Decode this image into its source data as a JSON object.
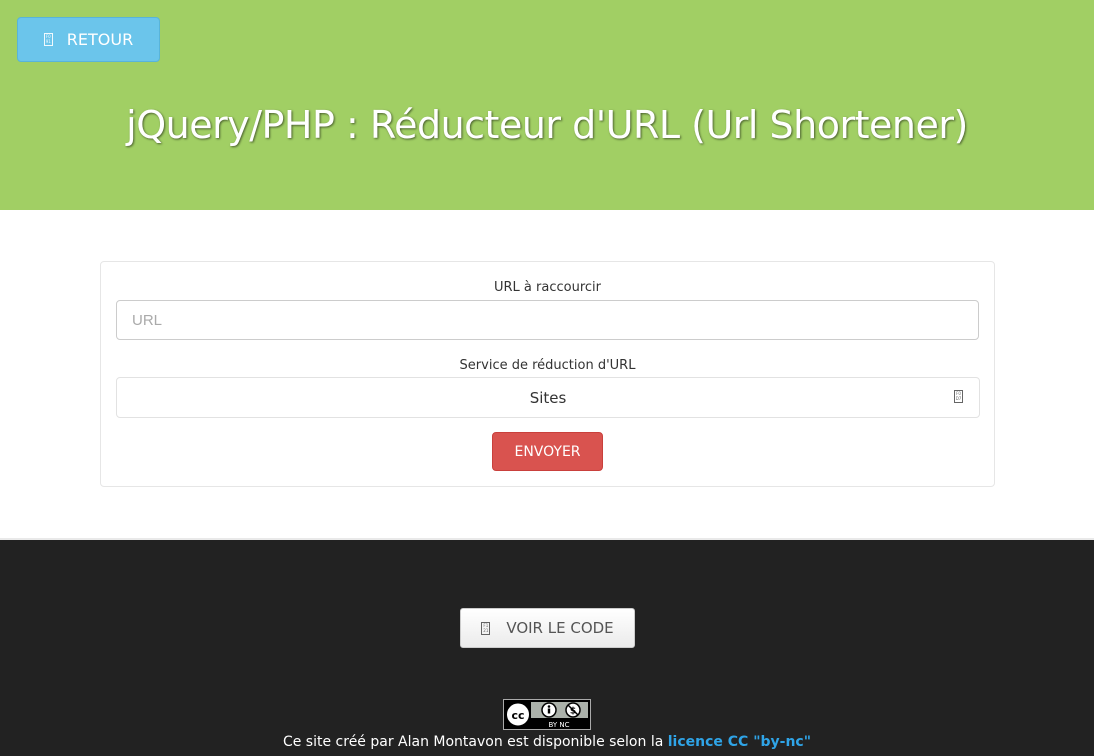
{
  "header": {
    "back_label": "RETOUR",
    "title": "jQuery/PHP : Réducteur d'URL (Url Shortener)",
    "bg_color": "#a1cf64"
  },
  "form": {
    "url_label": "URL à raccourcir",
    "url_placeholder": "URL",
    "url_value": "",
    "service_label": "Service de réduction d'URL",
    "service_selected": "Sites",
    "submit_label": "ENVOYER"
  },
  "footer": {
    "code_button_label": "VOIR LE CODE",
    "cc_badge_text": "BY NC",
    "credit_text": "Ce site créé par Alan Montavon est disponible selon la ",
    "license_link": "licence CC \"by-nc\""
  },
  "icons": {
    "back": "arrow-left-icon",
    "select_caret": "chevron-down-icon",
    "code": "code-icon"
  }
}
